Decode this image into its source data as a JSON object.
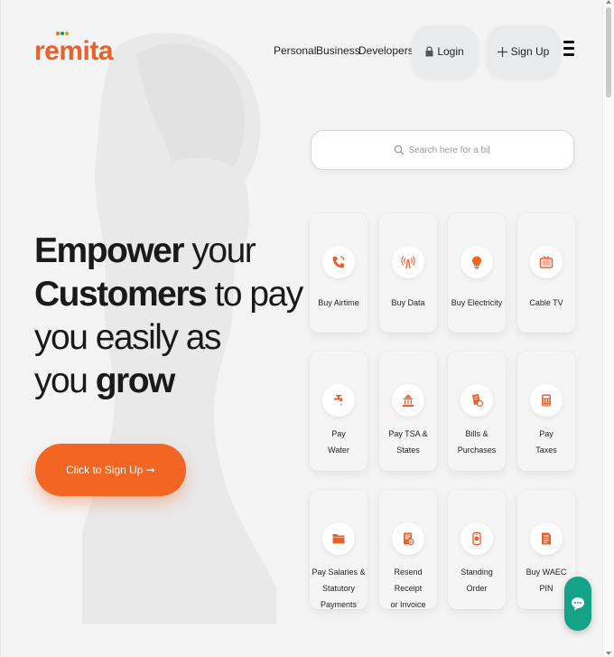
{
  "brand": {
    "logo_text": "remita",
    "accent": "#f26522",
    "dots": [
      "#f26522",
      "#2a8f4a",
      "#d8a11c"
    ]
  },
  "nav": {
    "items": [
      "Personal",
      "Business",
      "Developers"
    ]
  },
  "auth": {
    "login_label": "Login",
    "signup_label": "Sign Up"
  },
  "hero": {
    "line1_bold": "Empower",
    "line1_rest": " your",
    "line2_bold": "Customers",
    "line2_rest": " to pay",
    "line3": "you easily as",
    "line4_pre": "you ",
    "line4_bold": "grow"
  },
  "cta": {
    "label": "Click to Sign Up ➞"
  },
  "search": {
    "placeholder": "Search here for a biller",
    "icon": "search-icon"
  },
  "services": [
    {
      "label": "Buy Airtime",
      "icon": "phone-icon"
    },
    {
      "label": "Buy Data",
      "icon": "broadcast-icon"
    },
    {
      "label": "Buy Electricity",
      "icon": "bulb-icon"
    },
    {
      "label": "Cable TV",
      "icon": "tv-icon"
    },
    {
      "label": "Pay\nWater",
      "icon": "faucet-icon"
    },
    {
      "label": "Pay TSA &\nStates",
      "icon": "building-icon"
    },
    {
      "label": "Bills &\nPurchases",
      "icon": "bill-icon"
    },
    {
      "label": "Pay\nTaxes",
      "icon": "calculator-icon"
    },
    {
      "label": "Pay Salaries &\nStatutory Payments",
      "icon": "folder-icon"
    },
    {
      "label": "Resend Receipt\nor Invoice",
      "icon": "receipt-icon"
    },
    {
      "label": "Standing\nOrder",
      "icon": "order-icon"
    },
    {
      "label": "Buy WAEC\nPIN",
      "icon": "document-icon"
    }
  ],
  "chat": {
    "icon": "chat-icon",
    "color": "#14a388"
  }
}
